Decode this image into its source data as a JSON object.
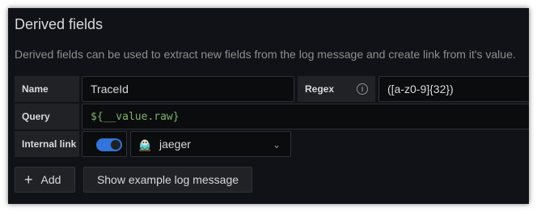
{
  "section": {
    "title": "Derived fields",
    "description": "Derived fields can be used to extract new fields from the log message and create link from it's value."
  },
  "field": {
    "name_label": "Name",
    "name_value": "TraceId",
    "regex_label": "Regex",
    "regex_value": "([a-z0-9]{32})",
    "query_label": "Query",
    "query_value": "${__value.raw}",
    "internal_link_label": "Internal link",
    "internal_link_enabled": true,
    "datasource_value": "jaeger"
  },
  "buttons": {
    "add_label": "Add",
    "show_example_label": "Show example log message"
  },
  "icons": {
    "info": "info-icon",
    "datasource": "jaeger-logo-icon",
    "chevron": "chevron-down-icon",
    "add": "plus-icon"
  },
  "colors": {
    "background": "#111217",
    "toggle_on": "#3274d9",
    "query_text": "#7eb26d"
  }
}
